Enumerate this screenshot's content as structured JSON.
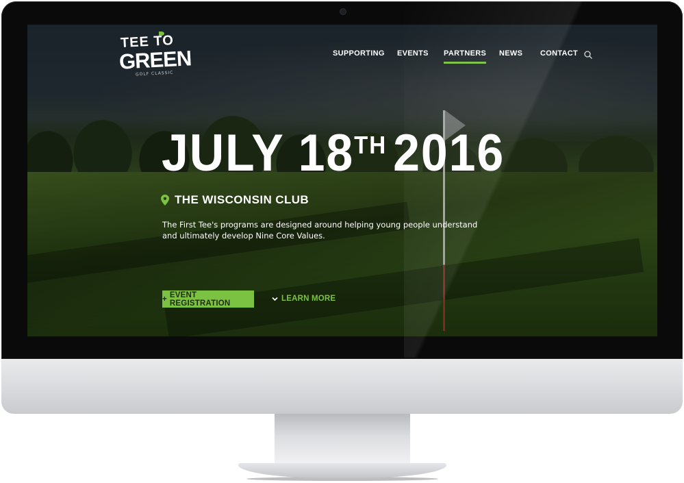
{
  "brand": {
    "logo_top": "TEE TO",
    "logo_main": "GREEN",
    "logo_sub": "GOLF CLASSIC"
  },
  "nav": {
    "items": [
      {
        "label": "SUPPORTING"
      },
      {
        "label": "EVENTS"
      },
      {
        "label": "PARTNERS",
        "active": true
      },
      {
        "label": "NEWS"
      },
      {
        "label": "CONTACT"
      }
    ],
    "search_icon": "search-icon"
  },
  "hero": {
    "date_main": "JULY 18",
    "date_suffix": "TH",
    "date_year": "2016",
    "venue": "THE WISCONSIN CLUB",
    "venue_icon": "map-pin-icon",
    "description": "The First Tee's programs are designed around helping young people understand and ultimately develop Nine Core Values.",
    "primary_button": "EVENT REGISTRATION",
    "primary_button_icon": "+",
    "secondary_link": "LEARN MORE",
    "secondary_link_icon": "chevron-down-icon"
  },
  "colors": {
    "accent": "#7cc242",
    "text": "#ffffff"
  }
}
